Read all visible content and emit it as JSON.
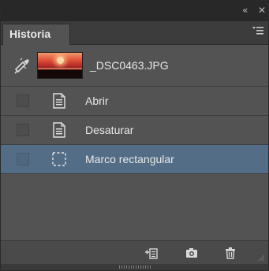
{
  "window": {
    "collapse_glyph": "«",
    "close_glyph": "✕"
  },
  "tabs": [
    {
      "label": "Historia",
      "active": true
    }
  ],
  "snapshot": {
    "label": "_DSC0463.JPG",
    "thumbnail": "sunset-thumbnail"
  },
  "states": [
    {
      "label": "Abrir",
      "icon": "document-icon",
      "selected": false
    },
    {
      "label": "Desaturar",
      "icon": "document-icon",
      "selected": false
    },
    {
      "label": "Marco rectangular",
      "icon": "marquee-icon",
      "selected": true
    }
  ],
  "toolbar": {
    "new_document_icon": "new-document-from-state-icon",
    "snapshot_icon": "camera-icon",
    "delete_icon": "trash-icon"
  },
  "colors": {
    "panel_bg": "#535353",
    "selected_row": "#546d86",
    "top_strip": "#282828",
    "tab_strip": "#3c3c3c"
  }
}
